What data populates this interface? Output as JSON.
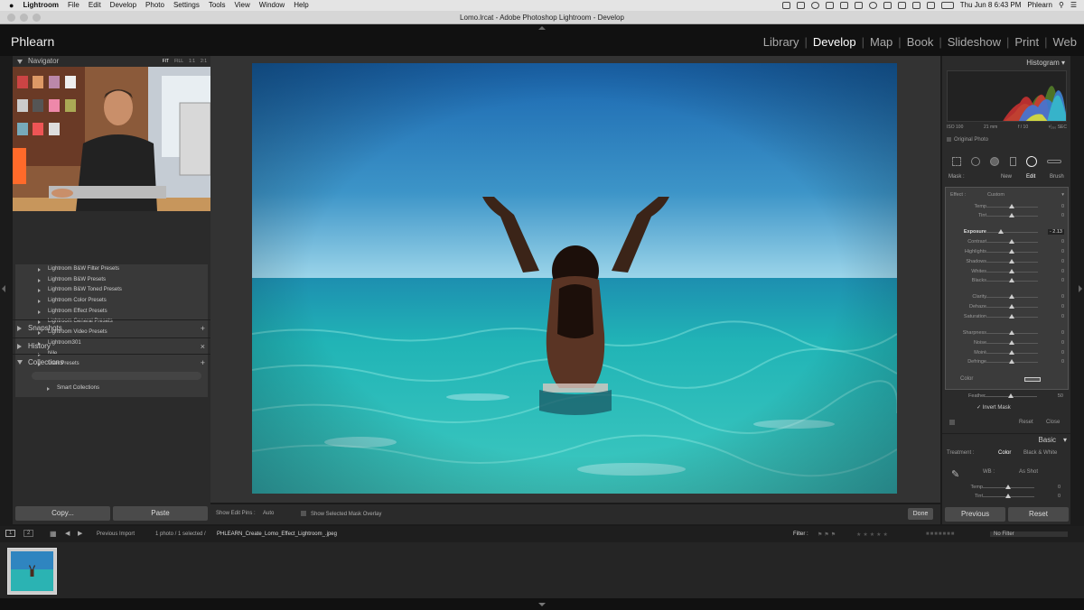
{
  "menubar": {
    "apple": "",
    "app": "Lightroom",
    "items": [
      "File",
      "Edit",
      "Develop",
      "Photo",
      "Settings",
      "Tools",
      "View",
      "Window",
      "Help"
    ],
    "clock": "Thu Jun 8  6:43 PM",
    "user": "Phlearn"
  },
  "window": {
    "title": "Lomo.lrcat - Adobe Photoshop Lightroom - Develop"
  },
  "topbar": {
    "identity": "Phlearn",
    "modules": [
      "Library",
      "Develop",
      "Map",
      "Book",
      "Slideshow",
      "Print",
      "Web"
    ],
    "active_module": "Develop"
  },
  "left": {
    "navigator": {
      "label": "Navigator",
      "options": [
        "FIT",
        "FILL",
        "1:1",
        "2:1"
      ],
      "active": "FIT"
    },
    "presets": [
      "Lightroom B&W Filter Presets",
      "Lightroom B&W Presets",
      "Lightroom B&W Toned Presets",
      "Lightroom Color Presets",
      "Lightroom Effect Presets",
      "Lightroom General Presets",
      "Lightroom Video Presets",
      "Lightroom301",
      "Nile",
      "User Presets"
    ],
    "snapshots": {
      "label": "Snapshots",
      "action": "+"
    },
    "history": {
      "label": "History",
      "action": "×"
    },
    "collections": {
      "label": "Collections",
      "action": "+",
      "items": [
        "Smart Collections"
      ]
    },
    "copy": "Copy...",
    "paste": "Paste"
  },
  "center": {
    "show_pins_label": "Show Edit Pins :",
    "show_pins_value": "Auto",
    "mask_overlay": "Show Selected Mask Overlay",
    "done": "Done"
  },
  "right": {
    "histogram": {
      "label": "Histogram",
      "iso": "ISO 100",
      "focal": "21 mm",
      "aperture": "f / 10",
      "shutter": "¹⁄₂₅₀ SEC",
      "original": "Original Photo"
    },
    "mask": {
      "label": "Mask :",
      "new": "New",
      "edit": "Edit",
      "brush": "Brush"
    },
    "effect": {
      "label": "Effect :",
      "value": "Custom"
    },
    "sliders": [
      {
        "name": "Temp",
        "value": "0",
        "pos": 0.5
      },
      {
        "name": "Tint",
        "value": "0",
        "pos": 0.5
      },
      {
        "name": "Exposure",
        "value": "- 2.13",
        "pos": 0.29,
        "highlight": true
      },
      {
        "name": "Contrast",
        "value": "0",
        "pos": 0.5
      },
      {
        "name": "Highlights",
        "value": "0",
        "pos": 0.5
      },
      {
        "name": "Shadows",
        "value": "0",
        "pos": 0.5
      },
      {
        "name": "Whites",
        "value": "0",
        "pos": 0.5
      },
      {
        "name": "Blacks",
        "value": "0",
        "pos": 0.5
      },
      {
        "name": "Clarity",
        "value": "0",
        "pos": 0.5
      },
      {
        "name": "Dehaze",
        "value": "0",
        "pos": 0.5
      },
      {
        "name": "Saturation",
        "value": "0",
        "pos": 0.5
      },
      {
        "name": "Sharpness",
        "value": "0",
        "pos": 0.5
      },
      {
        "name": "Noise",
        "value": "0",
        "pos": 0.5
      },
      {
        "name": "Moiré",
        "value": "0",
        "pos": 0.5
      },
      {
        "name": "Defringe",
        "value": "0",
        "pos": 0.5
      }
    ],
    "color_label": "Color",
    "feather": {
      "label": "Feather",
      "value": "50",
      "pos": 0.5
    },
    "invert_mask": "Invert Mask",
    "reset": "Reset",
    "close": "Close",
    "basic": {
      "label": "Basic",
      "treatment": "Treatment :",
      "color": "Color",
      "bw": "Black & White",
      "wb_label": "WB :",
      "wb_value": "As Shot",
      "temp": {
        "name": "Temp",
        "value": "0",
        "pos": 0.5
      },
      "tint": {
        "name": "Tint",
        "value": "0",
        "pos": 0.5
      }
    },
    "previous": "Previous",
    "reset_btn": "Reset"
  },
  "filmstrip": {
    "pages": [
      "1",
      "2"
    ],
    "source": "Previous Import",
    "count": "1 photo / 1 selected /",
    "filename": "PHLEARN_Create_Lomo_Effect_Lightroom_.jpeg",
    "filter_label": "Filter :",
    "filter_value": "No Filter"
  },
  "colors": {
    "panel": "#2b2b2b",
    "sky_top": "#1f6fb5",
    "sky_bottom": "#8fd0e6",
    "water": "#2bb7b0"
  }
}
